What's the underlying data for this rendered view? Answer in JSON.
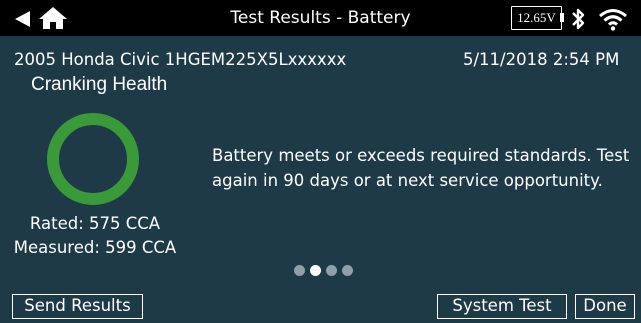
{
  "header": {
    "title": "Test Results - Battery",
    "voltage": "12.65V",
    "icons": [
      "back-arrow-icon",
      "home-icon",
      "battery-voltage-icon",
      "bluetooth-icon",
      "wifi-icon"
    ]
  },
  "info": {
    "vehicle": "2005 Honda Civic 1HGEM225X5Lxxxxxx",
    "datetime": "5/11/2018  2:54 PM"
  },
  "result": {
    "section_title": "Cranking Health",
    "rated": "Rated: 575 CCA",
    "measured": "Measured: 599 CCA",
    "message": "Battery meets or exceeds required standards. Test again in 90 days or at next service opportunity.",
    "status_color": "#3a9a3a"
  },
  "pager": {
    "count": 4,
    "active_index": 1
  },
  "buttons": {
    "send": "Send Results",
    "system": "System Test",
    "done": "Done"
  }
}
